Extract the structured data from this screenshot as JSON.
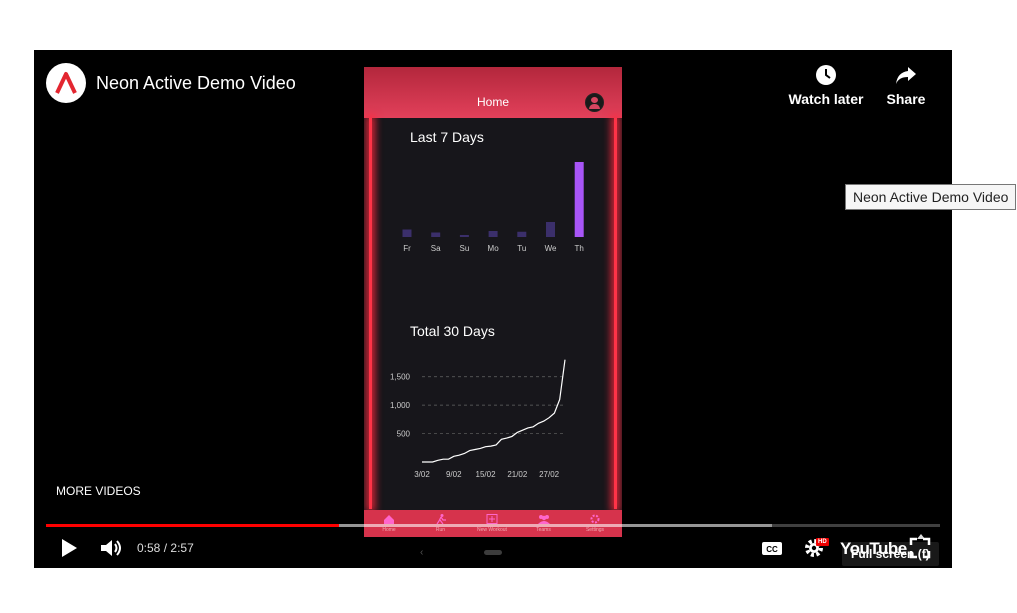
{
  "video": {
    "title": "Neon Active Demo Video",
    "actions": [
      {
        "label": "Watch later",
        "icon": "clock-icon"
      },
      {
        "label": "Share",
        "icon": "share-arrow-icon"
      }
    ],
    "more_videos_label": "MORE VIDEOS",
    "tooltip": "Full screen (f)",
    "hover_tooltip": "Neon Active Demo Video",
    "time": {
      "current": "0:58",
      "separator": "/",
      "duration": "2:57"
    },
    "progress": {
      "played_fraction": 0.328,
      "buffered_fraction": 0.812
    },
    "hd_badge": "HD",
    "youtube_logo": "YouTube",
    "colors": {
      "progress": "#ff0000",
      "accent": "#e2405a",
      "bar_highlight": "#a855f7",
      "bar_normal": "#3b2f6b"
    }
  },
  "app": {
    "header_title": "Home",
    "last7": {
      "title": "Last 7 Days"
    },
    "total30": {
      "title": "Total 30 Days"
    },
    "nav": [
      {
        "label": "Home",
        "icon": "home-icon"
      },
      {
        "label": "Run",
        "icon": "runner-icon"
      },
      {
        "label": "New Workout",
        "icon": "plus-box-icon"
      },
      {
        "label": "Teams",
        "icon": "people-icon"
      },
      {
        "label": "Settings",
        "icon": "gear-icon"
      }
    ]
  },
  "chart_data": [
    {
      "type": "bar",
      "title": "Last 7 Days",
      "categories": [
        "Fr",
        "Sa",
        "Su",
        "Mo",
        "Tu",
        "We",
        "Th"
      ],
      "values": [
        10,
        6,
        0,
        8,
        7,
        20,
        100
      ],
      "grid": false
    },
    {
      "type": "line",
      "title": "Total 30 Days",
      "x": [
        "3/02",
        "4/02",
        "5/02",
        "6/02",
        "7/02",
        "8/02",
        "9/02",
        "10/02",
        "11/02",
        "12/02",
        "13/02",
        "14/02",
        "15/02",
        "16/02",
        "17/02",
        "18/02",
        "19/02",
        "20/02",
        "21/02",
        "22/02",
        "23/02",
        "24/02",
        "25/02",
        "26/02",
        "27/02",
        "28/02",
        "1/03",
        "2/03"
      ],
      "x_ticks": [
        "3/02",
        "9/02",
        "15/02",
        "21/02",
        "27/02"
      ],
      "y": [
        0,
        0,
        0,
        30,
        50,
        50,
        100,
        120,
        150,
        200,
        220,
        240,
        270,
        280,
        300,
        400,
        420,
        450,
        520,
        560,
        600,
        620,
        680,
        720,
        780,
        860,
        1100,
        1800
      ],
      "y_ticks": [
        "500",
        "1,000",
        "1,500"
      ],
      "ylim": [
        0,
        1900
      ],
      "grid": true
    }
  ]
}
